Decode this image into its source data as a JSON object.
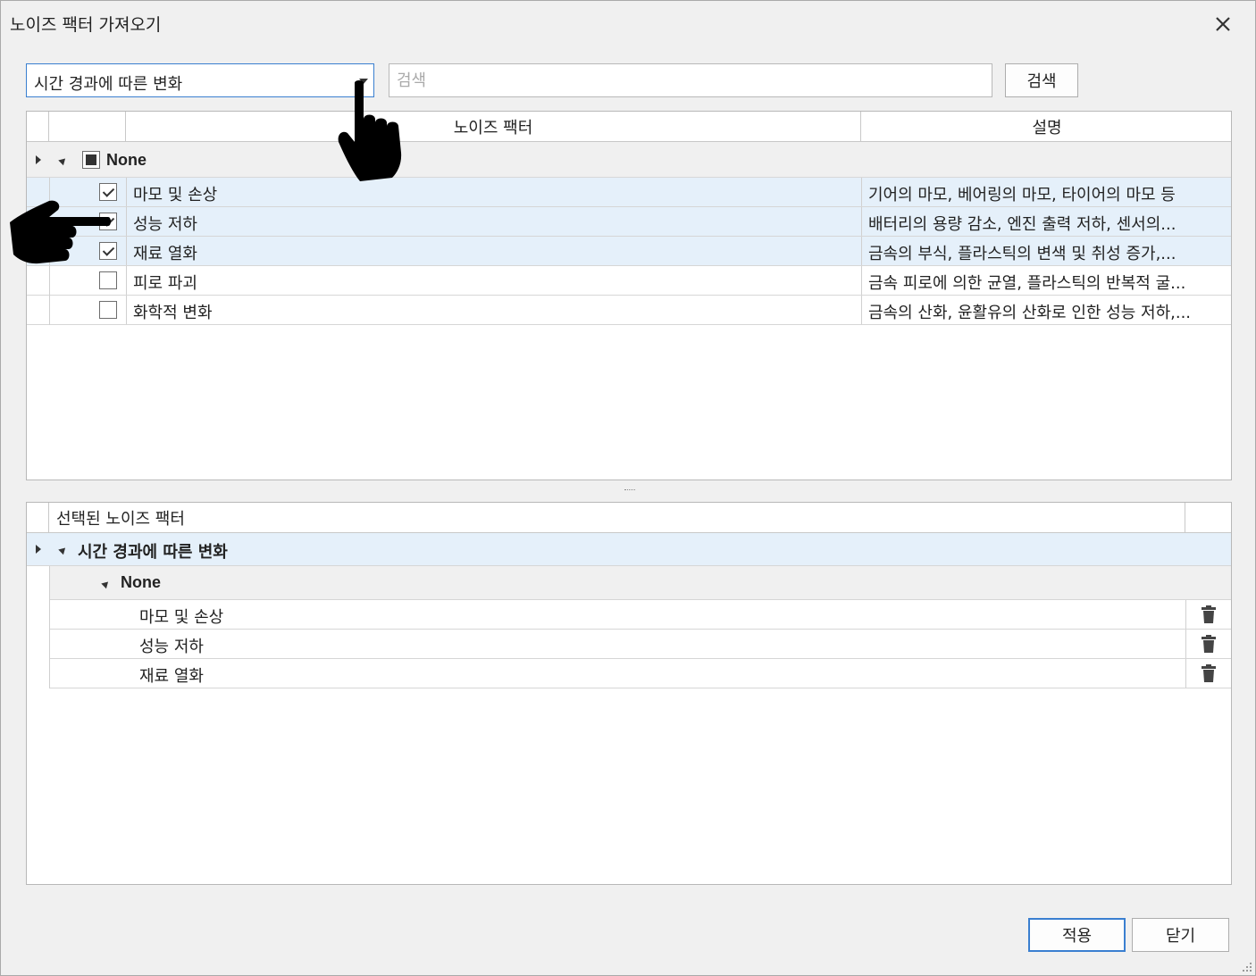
{
  "dialog": {
    "title": "노이즈 팩터 가져오기"
  },
  "toolbar": {
    "category_selected": "시간 경과에 따른 변화",
    "search_placeholder": "검색",
    "search_label": "검색"
  },
  "factor_grid": {
    "columns": [
      "노이즈 팩터",
      "설명"
    ],
    "group_label": "None",
    "rows": [
      {
        "name": "마모 및 손상",
        "description": "기어의 마모, 베어링의 마모, 타이어의 마모 등",
        "checked": true
      },
      {
        "name": "성능 저하",
        "description": "배터리의 용량 감소, 엔진 출력 저하, 센서의...",
        "checked": true
      },
      {
        "name": "재료 열화",
        "description": "금속의 부식, 플라스틱의 변색 및 취성 증가,...",
        "checked": true
      },
      {
        "name": "피로 파괴",
        "description": "금속 피로에 의한 균열, 플라스틱의 반복적 굴...",
        "checked": false
      },
      {
        "name": "화학적 변화",
        "description": "금속의 산화, 윤활유의 산화로 인한 성능 저하,...",
        "checked": false
      }
    ]
  },
  "selected_grid": {
    "header": "선택된 노이즈 팩터",
    "category_group": "시간 경과에 따른 변화",
    "sub_group": "None",
    "items": [
      "마모 및 손상",
      "성능 저하",
      "재료 열화"
    ]
  },
  "footer": {
    "apply_label": "적용",
    "close_label": "닫기"
  }
}
